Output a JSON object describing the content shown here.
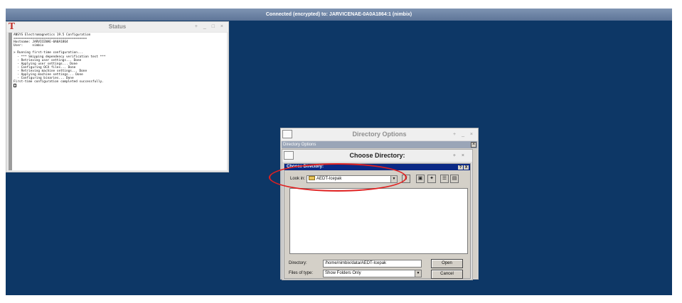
{
  "vnc": {
    "banner": "Connected (encrypted) to: JARVICENAE-0A0A1864:1 (nimbix)"
  },
  "status_window": {
    "title": "Status",
    "controls": "+ _ □ ×",
    "lines": [
      "ANSYS Electromagnetics 19.5 Configuration",
      "=======================================",
      "Hostname: JARVICENAE-0A0A1864",
      "User:     nimbix",
      "",
      "> Running first-time configuration...",
      "  - *** Skipping dependency verification test ***",
      "  - Retrieving user settings... Done",
      "  - Applying user settings... Done",
      "  - Configuring OCX files... Done",
      "  - Retrieving machine settings... Done",
      "  - Applying machine settings... Done",
      "  - Configuring binaries... Done",
      "First-time configuration completed successfully."
    ]
  },
  "directory_options": {
    "title": "Directory Options",
    "controls": "+ _ ×",
    "inner_title": "Directory Options"
  },
  "choose_directory": {
    "title": "Choose Directory:",
    "controls": "+ ×",
    "dialog_title": "Choose Directory:",
    "dialog_buttons": [
      "?",
      "X"
    ],
    "look_in_label": "Look in:",
    "look_in_value": "AEDT-Icepak",
    "directory_label": "Directory:",
    "directory_value": "/home/nimbix/data/AEDT-Icepak",
    "files_of_type_label": "Files of type:",
    "files_of_type_value": "Show Folders Only",
    "open_label": "Open",
    "cancel_label": "Cancel"
  },
  "colors": {
    "desktop": "#0d3766",
    "annotation": "#e02020",
    "dialog_title": "#0b2a86"
  }
}
